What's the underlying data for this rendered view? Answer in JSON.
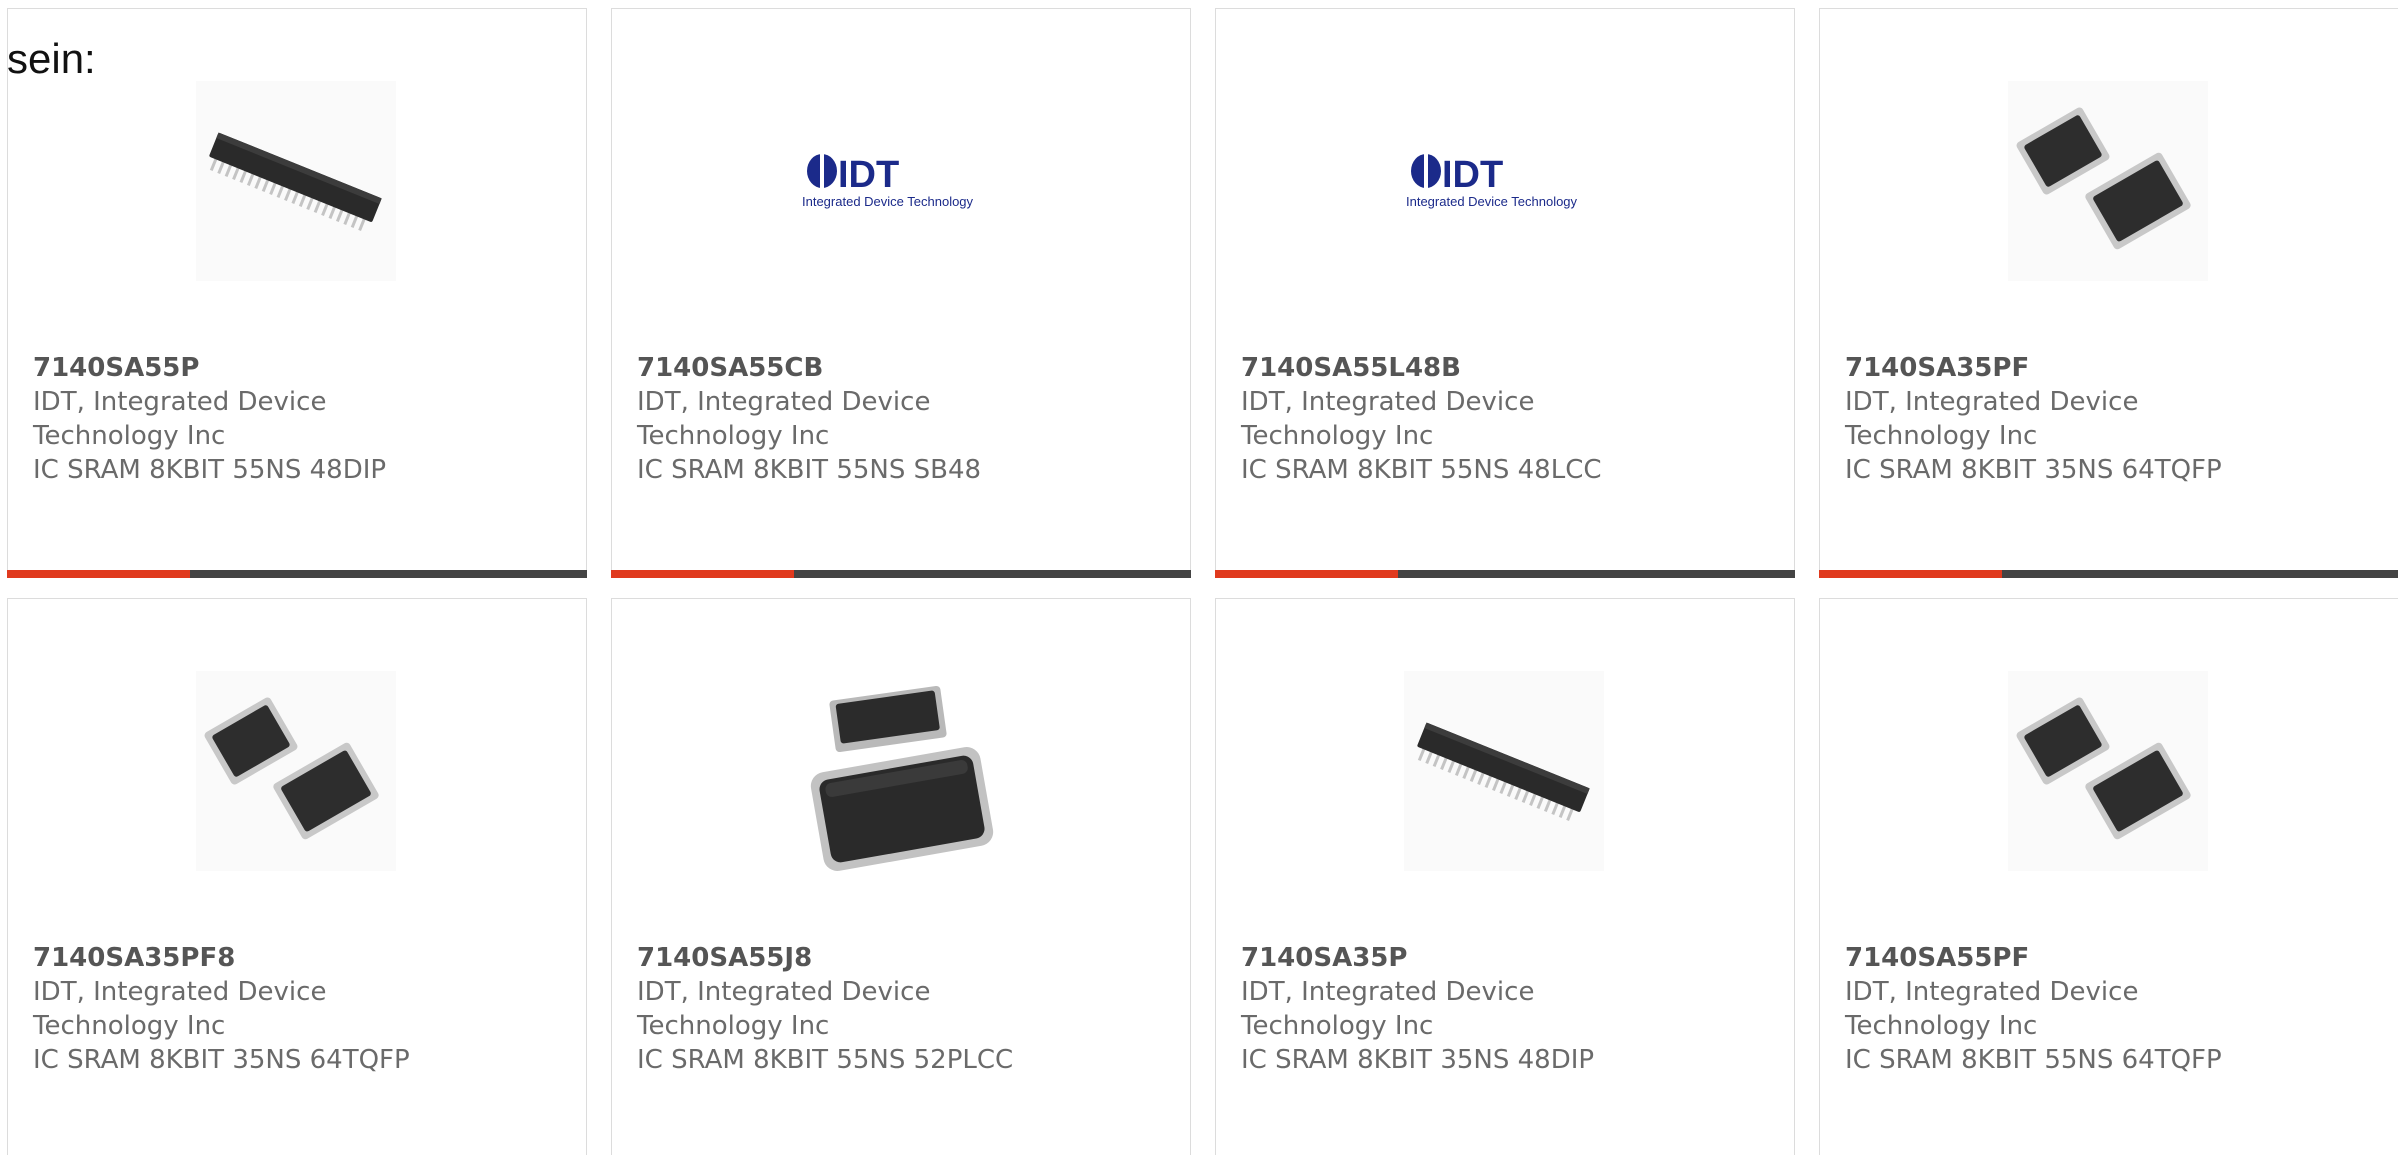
{
  "heading": "sein:",
  "colors": {
    "accent": "#e03a1e",
    "bar": "#444444",
    "card_border": "#dcdcdc",
    "text": "#6a6a6a"
  },
  "products": [
    {
      "part_number": "7140SA55P",
      "manufacturer": "IDT, Integrated Device Technology Inc",
      "description": "IC SRAM 8KBIT 55NS 48DIP",
      "image_icon": "dip-chip-icon"
    },
    {
      "part_number": "7140SA55CB",
      "manufacturer": "IDT, Integrated Device Technology Inc",
      "description": "IC SRAM 8KBIT 55NS SB48",
      "image_icon": "idt-logo-icon",
      "logo_text": "IDT",
      "logo_subtext": "Integrated Device Technology"
    },
    {
      "part_number": "7140SA55L48B",
      "manufacturer": "IDT, Integrated Device Technology Inc",
      "description": "IC SRAM 8KBIT 55NS 48LCC",
      "image_icon": "idt-logo-icon",
      "logo_text": "IDT",
      "logo_subtext": "Integrated Device Technology"
    },
    {
      "part_number": "7140SA35PF",
      "manufacturer": "IDT, Integrated Device Technology Inc",
      "description": "IC SRAM 8KBIT 35NS 64TQFP",
      "image_icon": "tqfp-chip-icon"
    },
    {
      "part_number": "7140SA35PF8",
      "manufacturer": "IDT, Integrated Device Technology Inc",
      "description": "IC SRAM 8KBIT 35NS 64TQFP",
      "image_icon": "tqfp-chip-icon"
    },
    {
      "part_number": "7140SA55J8",
      "manufacturer": "IDT, Integrated Device Technology Inc",
      "description": "IC SRAM 8KBIT 55NS 52PLCC",
      "image_icon": "plcc-chip-icon"
    },
    {
      "part_number": "7140SA35P",
      "manufacturer": "IDT, Integrated Device Technology Inc",
      "description": "IC SRAM 8KBIT 35NS 48DIP",
      "image_icon": "dip-chip-icon"
    },
    {
      "part_number": "7140SA55PF",
      "manufacturer": "IDT, Integrated Device Technology Inc",
      "description": "IC SRAM 8KBIT 55NS 64TQFP",
      "image_icon": "tqfp-chip-icon"
    }
  ]
}
